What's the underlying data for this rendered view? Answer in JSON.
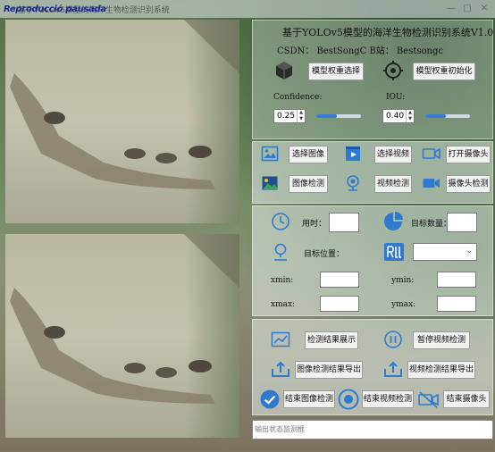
{
  "window": {
    "stamp": "Reproducció pausada",
    "title": "基于YOLOv5模型的海洋生物检测识别系统",
    "controls": [
      "—",
      "□",
      "✕"
    ]
  },
  "header": {
    "title": "基于YOLOv5模型的海洋生物检测识别系统V1.0",
    "credit": "CSDN：  BestSongC    B站：  Bestsongc"
  },
  "model": {
    "select_label": "模型权重选择",
    "init_label": "模型权重初始化"
  },
  "params": {
    "confidence_label": "Confidence:",
    "confidence_value": "0.25",
    "confidence_level": 0.45,
    "iou_label": "IOU:",
    "iou_value": "0.40",
    "iou_level": 0.45
  },
  "actions": {
    "select_image": "选择图像",
    "select_video": "选择视频",
    "open_camera": "打开摄像头",
    "image_detect": "图像检测",
    "video_detect": "视频检测",
    "camera_detect": "摄像头检测"
  },
  "results": {
    "time_label": "用时：",
    "time_value": "",
    "count_label": "目标数量：",
    "count_value": "",
    "position_label": "目标位置：",
    "position_select": "",
    "xmin_label": "xmin:",
    "ymin_label": "ymin:",
    "xmax_label": "xmax:",
    "ymax_label": "ymax:"
  },
  "controls": {
    "show_results": "检测结果展示",
    "pause_video": "暂停视频检测",
    "export_image": "图像检测结果导出",
    "export_video": "视频检测结果导出",
    "end_image": "结束图像检测",
    "end_video": "结束视频检测",
    "end_camera": "结束摄像头"
  },
  "status": {
    "placeholder": "输出状态监测框"
  },
  "colors": {
    "accent": "#2f7ad1",
    "button_bg": "#f1f1f1"
  }
}
